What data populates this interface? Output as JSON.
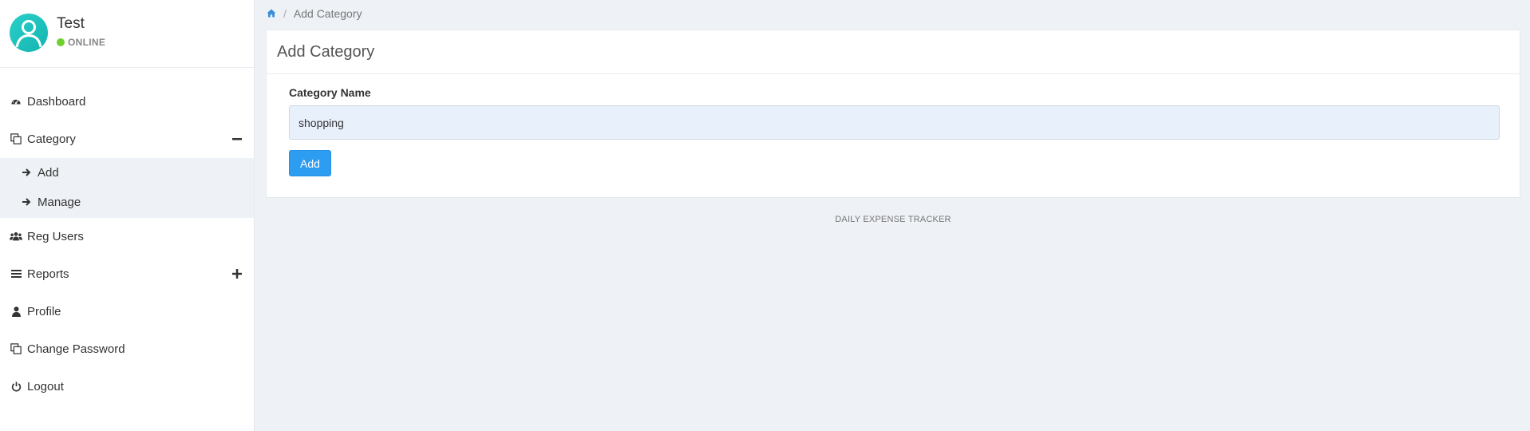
{
  "user": {
    "name": "Test",
    "status": "ONLINE",
    "status_color": "#6fcf2f",
    "avatar_color": "#1fc2bd"
  },
  "sidebar": {
    "items": [
      {
        "label": "Dashboard",
        "icon": "dashboard-icon"
      },
      {
        "label": "Category",
        "icon": "copy-icon",
        "toggle": "minus",
        "expanded": true,
        "subitems": [
          {
            "label": "Add",
            "icon": "arrow-right-icon"
          },
          {
            "label": "Manage",
            "icon": "arrow-right-icon"
          }
        ]
      },
      {
        "label": "Reg Users",
        "icon": "users-icon"
      },
      {
        "label": "Reports",
        "icon": "bars-icon",
        "toggle": "plus",
        "expanded": false
      },
      {
        "label": "Profile",
        "icon": "user-icon"
      },
      {
        "label": "Change Password",
        "icon": "copy-icon"
      },
      {
        "label": "Logout",
        "icon": "power-icon"
      }
    ]
  },
  "breadcrumb": {
    "home_icon": "home-icon",
    "separator": "/",
    "current": "Add Category"
  },
  "card": {
    "title": "Add Category",
    "field_label": "Category Name",
    "field_value": "shopping",
    "submit_label": "Add"
  },
  "footer": {
    "text": "DAILY EXPENSE TRACKER"
  },
  "colors": {
    "accent": "#2d9df2",
    "page_background": "#eef1f5",
    "input_background": "#e8f0fc"
  }
}
